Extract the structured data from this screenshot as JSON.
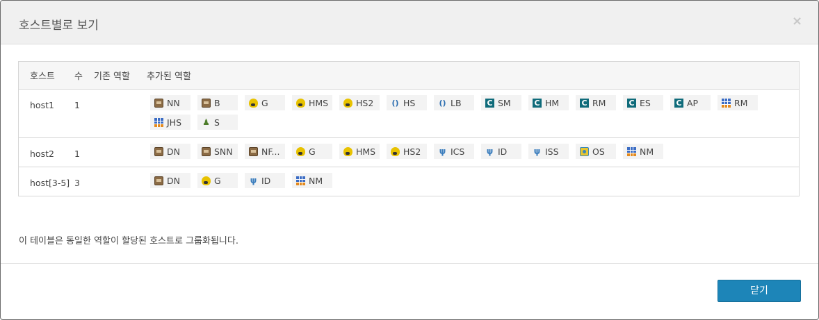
{
  "modal": {
    "title": "호스트별로 보기",
    "close_icon": "×",
    "footnote": "이 테이블은 동일한 역할이 할당된 호스트로 그룹화됩니다.",
    "close_button_label": "닫기"
  },
  "table": {
    "headers": [
      "호스트",
      "수",
      "기존 역할",
      "추가된 역할"
    ],
    "rows": [
      {
        "host": "host1",
        "count": "1",
        "existing": "",
        "roles": [
          {
            "label": "NN",
            "icon": "hdfs-icon"
          },
          {
            "label": "B",
            "icon": "hdfs-icon"
          },
          {
            "label": "G",
            "icon": "hive-icon"
          },
          {
            "label": "HMS",
            "icon": "hive-icon"
          },
          {
            "label": "HS2",
            "icon": "hive-icon"
          },
          {
            "label": "HS",
            "icon": "hue-icon"
          },
          {
            "label": "LB",
            "icon": "hue-icon"
          },
          {
            "label": "SM",
            "icon": "cloudera-icon"
          },
          {
            "label": "HM",
            "icon": "cloudera-icon"
          },
          {
            "label": "RM",
            "icon": "cloudera-icon"
          },
          {
            "label": "ES",
            "icon": "cloudera-icon"
          },
          {
            "label": "AP",
            "icon": "cloudera-icon"
          },
          {
            "label": "RM",
            "icon": "yarn-icon"
          },
          {
            "label": "JHS",
            "icon": "yarn-icon"
          },
          {
            "label": "S",
            "icon": "sqoop-icon"
          }
        ]
      },
      {
        "host": "host2",
        "count": "1",
        "existing": "",
        "roles": [
          {
            "label": "DN",
            "icon": "hdfs-icon"
          },
          {
            "label": "SNN",
            "icon": "hdfs-icon"
          },
          {
            "label": "NF...",
            "icon": "hdfs-icon"
          },
          {
            "label": "G",
            "icon": "hive-icon"
          },
          {
            "label": "HMS",
            "icon": "hive-icon"
          },
          {
            "label": "HS2",
            "icon": "hive-icon"
          },
          {
            "label": "ICS",
            "icon": "impala-icon"
          },
          {
            "label": "ID",
            "icon": "impala-icon"
          },
          {
            "label": "ISS",
            "icon": "impala-icon"
          },
          {
            "label": "OS",
            "icon": "oozie-icon"
          },
          {
            "label": "NM",
            "icon": "yarn-icon"
          }
        ]
      },
      {
        "host": "host[3-5]",
        "count": "3",
        "existing": "",
        "roles": [
          {
            "label": "DN",
            "icon": "hdfs-icon"
          },
          {
            "label": "G",
            "icon": "hive-icon"
          },
          {
            "label": "ID",
            "icon": "impala-icon"
          },
          {
            "label": "NM",
            "icon": "yarn-icon"
          }
        ]
      }
    ]
  }
}
